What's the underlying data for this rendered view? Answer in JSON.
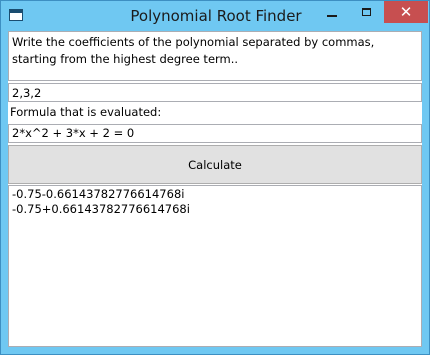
{
  "window": {
    "title": "Polynomial Root Finder",
    "close_glyph": "✕"
  },
  "instruction": "Write the coefficients of the polynomial separated by commas, starting from the highest degree term..",
  "coefficients_input": {
    "value": "2,3,2"
  },
  "formula": {
    "label": "Formula that is evaluated:",
    "value": "2*x^2 + 3*x + 2 = 0"
  },
  "calculate_button": {
    "label": "Calculate"
  },
  "results": [
    "-0.75-0.66143782776614768i",
    "-0.75+0.66143782776614768i"
  ],
  "colors": {
    "titlebar": "#6fc8f2",
    "close_button": "#c74f50",
    "button_face": "#e1e1e1",
    "border": "#abadb3"
  }
}
